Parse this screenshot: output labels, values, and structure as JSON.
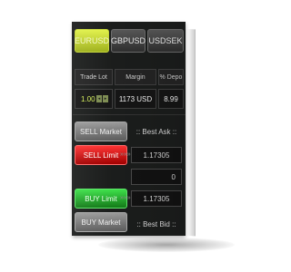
{
  "tabs": [
    {
      "label": "EURUSD",
      "active": true
    },
    {
      "label": "GBPUSD",
      "active": false
    },
    {
      "label": "USDSEK",
      "active": false
    }
  ],
  "columns": {
    "trade_lot": "Trade Lot",
    "margin": "Margin",
    "pct_depo": "% Depo"
  },
  "values": {
    "trade_lot": "1.00",
    "margin": "1173 USD",
    "pct_depo": "8.99"
  },
  "buttons": {
    "sell_market": "SELL Market",
    "sell_limit": "SELL Limit",
    "buy_limit": "BUY Limit",
    "buy_market": "BUY Market"
  },
  "quotes": {
    "best_ask_label": ":: Best Ask ::",
    "sell_limit_price": "1.17305",
    "spread": "0",
    "buy_limit_price": "1.17305",
    "best_bid_label": ":: Best Bid ::"
  },
  "arrows": "»»»",
  "colors": {
    "active_tab": "#c5d63a",
    "sell": "#d40000",
    "buy": "#1fa12a",
    "background": "#1b1d1c"
  }
}
